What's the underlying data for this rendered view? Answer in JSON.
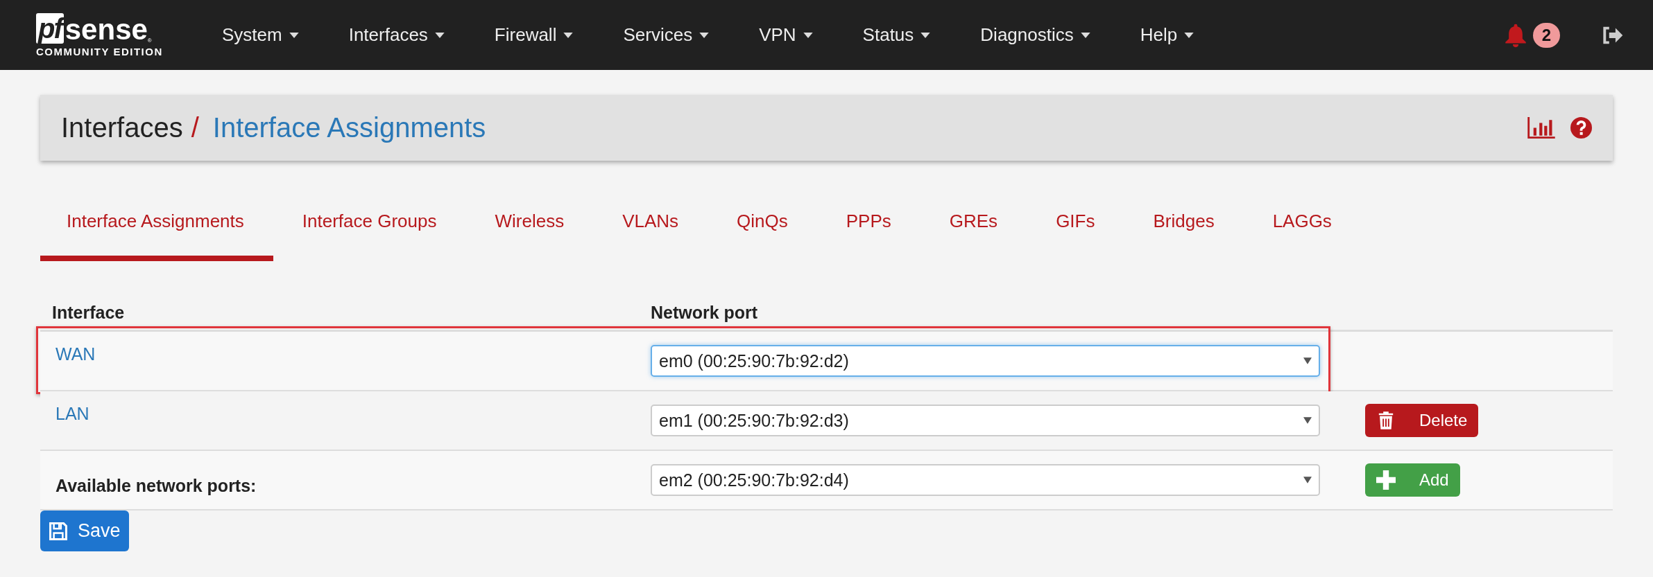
{
  "logo": {
    "mark": "pf",
    "name": "sense",
    "registered": "®",
    "edition": "COMMUNITY EDITION"
  },
  "nav": [
    {
      "label": "System"
    },
    {
      "label": "Interfaces"
    },
    {
      "label": "Firewall"
    },
    {
      "label": "Services"
    },
    {
      "label": "VPN"
    },
    {
      "label": "Status"
    },
    {
      "label": "Diagnostics"
    },
    {
      "label": "Help"
    }
  ],
  "notifications": {
    "count": "2"
  },
  "breadcrumb": {
    "parent": "Interfaces",
    "separator": "/",
    "current": "Interface Assignments"
  },
  "tabs": [
    {
      "label": "Interface Assignments",
      "selected": true
    },
    {
      "label": "Interface Groups",
      "selected": false
    },
    {
      "label": "Wireless",
      "selected": false
    },
    {
      "label": "VLANs",
      "selected": false
    },
    {
      "label": "QinQs",
      "selected": false
    },
    {
      "label": "PPPs",
      "selected": false
    },
    {
      "label": "GREs",
      "selected": false
    },
    {
      "label": "GIFs",
      "selected": false
    },
    {
      "label": "Bridges",
      "selected": false
    },
    {
      "label": "LAGGs",
      "selected": false
    }
  ],
  "table": {
    "columns": [
      "Interface",
      "Network port"
    ],
    "rows": [
      {
        "kind": "interface",
        "interface": "WAN",
        "port": "em0 (00:25:90:7b:92:d2)",
        "highlighted": true,
        "focused": true
      },
      {
        "kind": "interface",
        "interface": "LAN",
        "port": "em1 (00:25:90:7b:92:d3)",
        "highlighted": false,
        "focused": false,
        "action": {
          "kind": "delete",
          "label": "Delete"
        }
      },
      {
        "kind": "available",
        "interface": "Available network ports:",
        "port": "em2 (00:25:90:7b:92:d4)",
        "highlighted": false,
        "focused": false,
        "action": {
          "kind": "add",
          "label": "Add"
        }
      }
    ]
  },
  "save_button": {
    "label": "Save"
  }
}
